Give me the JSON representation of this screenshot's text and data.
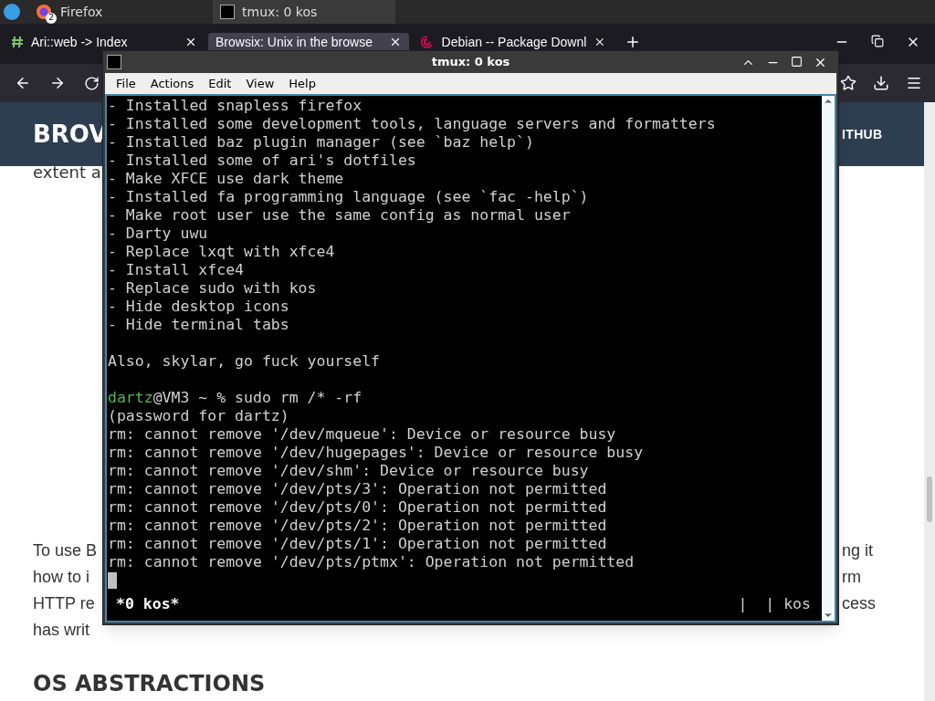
{
  "taskbar": {
    "tasks": [
      {
        "label": "Firefox",
        "badge": "2",
        "selected": false
      },
      {
        "label": "tmux: 0 kos",
        "selected": true
      }
    ]
  },
  "browser": {
    "tabs": [
      {
        "label": "Ari::web -> Index",
        "selected": false
      },
      {
        "label": "Browsix: Unix in the browse",
        "selected": true
      },
      {
        "label": "Debian -- Package Downl",
        "selected": false
      }
    ],
    "page": {
      "header_left": "BROV",
      "header_right": "ITHUB",
      "left_fragments": [
        "extent a"
      ],
      "para_left": [
        "To use B",
        "how to i",
        "HTTP re",
        "has writ"
      ],
      "para_right": [
        "ng it",
        "rm",
        "cess"
      ],
      "heading": "OS ABSTRACTIONS"
    }
  },
  "terminal": {
    "title": "tmux: 0 kos",
    "menu": [
      "File",
      "Actions",
      "Edit",
      "View",
      "Help"
    ],
    "lines": [
      {
        "kind": "text",
        "text": "- Installed snapless firefox"
      },
      {
        "kind": "text",
        "text": "- Installed some development tools, language servers and formatters"
      },
      {
        "kind": "text",
        "text": "- Installed baz plugin manager (see `baz help`)"
      },
      {
        "kind": "text",
        "text": "- Installed some of ari's dotfiles"
      },
      {
        "kind": "text",
        "text": "- Make XFCE use dark theme"
      },
      {
        "kind": "text",
        "text": "- Installed fa programming language (see `fac -help`)"
      },
      {
        "kind": "text",
        "text": "- Make root user use the same config as normal user"
      },
      {
        "kind": "text",
        "text": "- Darty uwu"
      },
      {
        "kind": "text",
        "text": "- Replace lxqt with xfce4"
      },
      {
        "kind": "text",
        "text": "- Install xfce4"
      },
      {
        "kind": "text",
        "text": "- Replace sudo with kos"
      },
      {
        "kind": "text",
        "text": "- Hide desktop icons"
      },
      {
        "kind": "text",
        "text": "- Hide terminal tabs"
      },
      {
        "kind": "blank"
      },
      {
        "kind": "text",
        "text": "Also, skylar, go fuck yourself"
      },
      {
        "kind": "blank"
      },
      {
        "kind": "prompt",
        "user": "dartz",
        "text": "@VM3 ~ % sudo rm /* -rf"
      },
      {
        "kind": "text",
        "text": "(password for dartz)"
      },
      {
        "kind": "text",
        "text": "rm: cannot remove '/dev/mqueue': Device or resource busy"
      },
      {
        "kind": "text",
        "text": "rm: cannot remove '/dev/hugepages': Device or resource busy"
      },
      {
        "kind": "text",
        "text": "rm: cannot remove '/dev/shm': Device or resource busy"
      },
      {
        "kind": "text",
        "text": "rm: cannot remove '/dev/pts/3': Operation not permitted"
      },
      {
        "kind": "text",
        "text": "rm: cannot remove '/dev/pts/0': Operation not permitted"
      },
      {
        "kind": "text",
        "text": "rm: cannot remove '/dev/pts/2': Operation not permitted"
      },
      {
        "kind": "text",
        "text": "rm: cannot remove '/dev/pts/1': Operation not permitted"
      },
      {
        "kind": "text",
        "text": "rm: cannot remove '/dev/pts/ptmx': Operation not permitted"
      },
      {
        "kind": "cursor"
      }
    ],
    "status_left": "*0 kos*",
    "status_right": "|  | kos"
  }
}
